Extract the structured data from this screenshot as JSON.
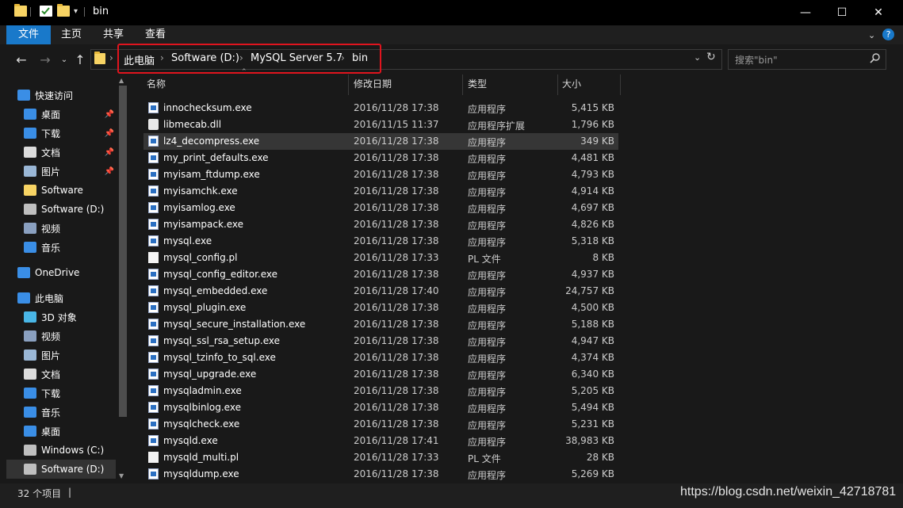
{
  "window": {
    "title": "bin",
    "minimize": "—",
    "maximize": "☐",
    "close": "✕"
  },
  "ribbon": {
    "tabs": [
      "文件",
      "主页",
      "共享",
      "查看"
    ],
    "help": "?"
  },
  "address": {
    "crumbs": [
      "此电脑",
      "Software (D:)",
      "MySQL Server 5.7",
      "bin"
    ],
    "search_placeholder": "搜索\"bin\""
  },
  "nav": {
    "items": [
      {
        "label": "快速访问",
        "icon": "star-icon",
        "pinned": false
      },
      {
        "label": "桌面",
        "icon": "desktop-icon",
        "pinned": true
      },
      {
        "label": "下载",
        "icon": "download-icon",
        "pinned": true
      },
      {
        "label": "文档",
        "icon": "document-icon",
        "pinned": true
      },
      {
        "label": "图片",
        "icon": "pictures-icon",
        "pinned": true
      },
      {
        "label": "Software",
        "icon": "folder-icon",
        "pinned": false
      },
      {
        "label": "Software (D:)",
        "icon": "drive-icon",
        "pinned": false
      },
      {
        "label": "视频",
        "icon": "video-icon",
        "pinned": false
      },
      {
        "label": "音乐",
        "icon": "music-icon",
        "pinned": false
      },
      {
        "label": "OneDrive",
        "icon": "cloud-icon",
        "pinned": false
      },
      {
        "label": "此电脑",
        "icon": "computer-icon",
        "pinned": false
      },
      {
        "label": "3D 对象",
        "icon": "cube-icon",
        "pinned": false
      },
      {
        "label": "视频",
        "icon": "video-icon",
        "pinned": false
      },
      {
        "label": "图片",
        "icon": "pictures-icon",
        "pinned": false
      },
      {
        "label": "文档",
        "icon": "document-icon",
        "pinned": false
      },
      {
        "label": "下载",
        "icon": "download-icon",
        "pinned": false
      },
      {
        "label": "音乐",
        "icon": "music-icon",
        "pinned": false
      },
      {
        "label": "桌面",
        "icon": "desktop-icon",
        "pinned": false
      },
      {
        "label": "Windows (C:)",
        "icon": "windows-drive-icon",
        "pinned": false
      },
      {
        "label": "Software (D:)",
        "icon": "drive-icon",
        "pinned": false
      }
    ]
  },
  "columns": {
    "name": "名称",
    "date": "修改日期",
    "type": "类型",
    "size": "大小"
  },
  "files": [
    {
      "name": "innochecksum.exe",
      "date": "2016/11/28 17:38",
      "type": "应用程序",
      "size": "5,415 KB",
      "icon": "exe"
    },
    {
      "name": "libmecab.dll",
      "date": "2016/11/15 11:37",
      "type": "应用程序扩展",
      "size": "1,796 KB",
      "icon": "dll"
    },
    {
      "name": "lz4_decompress.exe",
      "date": "2016/11/28 17:38",
      "type": "应用程序",
      "size": "349 KB",
      "icon": "exe"
    },
    {
      "name": "my_print_defaults.exe",
      "date": "2016/11/28 17:38",
      "type": "应用程序",
      "size": "4,481 KB",
      "icon": "exe"
    },
    {
      "name": "myisam_ftdump.exe",
      "date": "2016/11/28 17:38",
      "type": "应用程序",
      "size": "4,793 KB",
      "icon": "exe"
    },
    {
      "name": "myisamchk.exe",
      "date": "2016/11/28 17:38",
      "type": "应用程序",
      "size": "4,914 KB",
      "icon": "exe"
    },
    {
      "name": "myisamlog.exe",
      "date": "2016/11/28 17:38",
      "type": "应用程序",
      "size": "4,697 KB",
      "icon": "exe"
    },
    {
      "name": "myisampack.exe",
      "date": "2016/11/28 17:38",
      "type": "应用程序",
      "size": "4,826 KB",
      "icon": "exe"
    },
    {
      "name": "mysql.exe",
      "date": "2016/11/28 17:38",
      "type": "应用程序",
      "size": "5,318 KB",
      "icon": "exe"
    },
    {
      "name": "mysql_config.pl",
      "date": "2016/11/28 17:33",
      "type": "PL 文件",
      "size": "8 KB",
      "icon": "txt"
    },
    {
      "name": "mysql_config_editor.exe",
      "date": "2016/11/28 17:38",
      "type": "应用程序",
      "size": "4,937 KB",
      "icon": "exe"
    },
    {
      "name": "mysql_embedded.exe",
      "date": "2016/11/28 17:40",
      "type": "应用程序",
      "size": "24,757 KB",
      "icon": "exe"
    },
    {
      "name": "mysql_plugin.exe",
      "date": "2016/11/28 17:38",
      "type": "应用程序",
      "size": "4,500 KB",
      "icon": "exe"
    },
    {
      "name": "mysql_secure_installation.exe",
      "date": "2016/11/28 17:38",
      "type": "应用程序",
      "size": "5,188 KB",
      "icon": "exe"
    },
    {
      "name": "mysql_ssl_rsa_setup.exe",
      "date": "2016/11/28 17:38",
      "type": "应用程序",
      "size": "4,947 KB",
      "icon": "exe"
    },
    {
      "name": "mysql_tzinfo_to_sql.exe",
      "date": "2016/11/28 17:38",
      "type": "应用程序",
      "size": "4,374 KB",
      "icon": "exe"
    },
    {
      "name": "mysql_upgrade.exe",
      "date": "2016/11/28 17:38",
      "type": "应用程序",
      "size": "6,340 KB",
      "icon": "exe"
    },
    {
      "name": "mysqladmin.exe",
      "date": "2016/11/28 17:38",
      "type": "应用程序",
      "size": "5,205 KB",
      "icon": "exe"
    },
    {
      "name": "mysqlbinlog.exe",
      "date": "2016/11/28 17:38",
      "type": "应用程序",
      "size": "5,494 KB",
      "icon": "exe"
    },
    {
      "name": "mysqlcheck.exe",
      "date": "2016/11/28 17:38",
      "type": "应用程序",
      "size": "5,231 KB",
      "icon": "exe"
    },
    {
      "name": "mysqld.exe",
      "date": "2016/11/28 17:41",
      "type": "应用程序",
      "size": "38,983 KB",
      "icon": "exe"
    },
    {
      "name": "mysqld_multi.pl",
      "date": "2016/11/28 17:33",
      "type": "PL 文件",
      "size": "28 KB",
      "icon": "txt"
    },
    {
      "name": "mysqldump.exe",
      "date": "2016/11/28 17:38",
      "type": "应用程序",
      "size": "5,269 KB",
      "icon": "exe"
    }
  ],
  "status": "32 个项目",
  "watermark": "https://blog.csdn.net/weixin_42718781",
  "colors": {
    "accent": "#1979ca",
    "highlight": "#e0141e",
    "background": "#191919"
  }
}
